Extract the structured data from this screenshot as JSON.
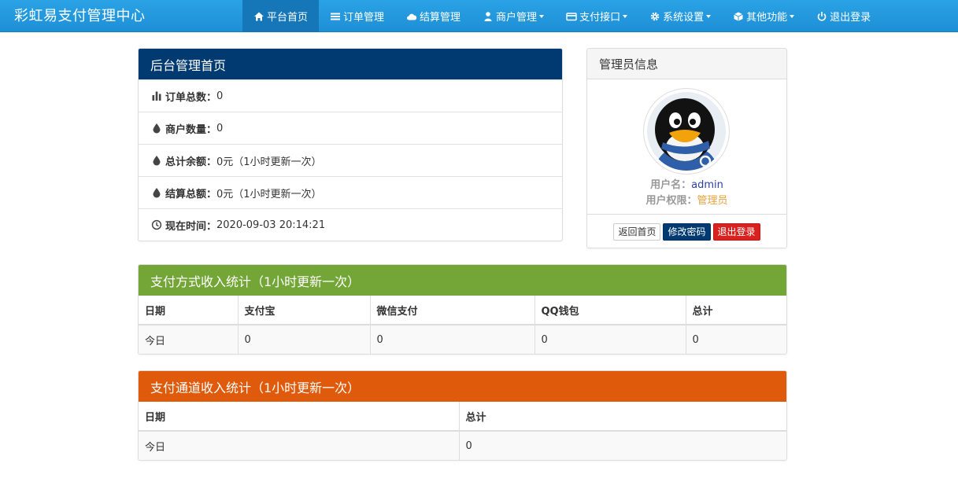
{
  "nav": {
    "brand": "彩虹易支付管理中心",
    "items": [
      {
        "label": "平台首页",
        "icon": "home-icon",
        "dropdown": false,
        "active": true
      },
      {
        "label": "订单管理",
        "icon": "list-icon",
        "dropdown": false,
        "active": false
      },
      {
        "label": "结算管理",
        "icon": "cloud-icon",
        "dropdown": false,
        "active": false
      },
      {
        "label": "商户管理",
        "icon": "user-icon",
        "dropdown": true,
        "active": false
      },
      {
        "label": "支付接口",
        "icon": "credit-card-icon",
        "dropdown": true,
        "active": false
      },
      {
        "label": "系统设置",
        "icon": "cog-icon",
        "dropdown": true,
        "active": false
      },
      {
        "label": "其他功能",
        "icon": "cube-icon",
        "dropdown": true,
        "active": false
      },
      {
        "label": "退出登录",
        "icon": "power-icon",
        "dropdown": false,
        "active": false
      }
    ]
  },
  "home": {
    "title": "后台管理首页",
    "rows": [
      {
        "icon": "stats-icon",
        "label": "订单总数：",
        "value": "0"
      },
      {
        "icon": "drop-icon",
        "label": "商户数量：",
        "value": "0"
      },
      {
        "icon": "drop-icon",
        "label": "总计余额：",
        "value": "0元（1小时更新一次）"
      },
      {
        "icon": "drop-icon",
        "label": "结算总额：",
        "value": "0元（1小时更新一次）"
      },
      {
        "icon": "clock-icon",
        "label": "现在时间：",
        "value": " 2020-09-03 20:14:21"
      }
    ]
  },
  "admin": {
    "title": "管理员信息",
    "username_label": "用户名：",
    "username": "admin",
    "role_label": "用户权限：",
    "role": "管理员",
    "buttons": {
      "home": "返回首页",
      "password": "修改密码",
      "logout": "退出登录"
    }
  },
  "pay_stats": {
    "title": "支付方式收入统计（1小时更新一次）",
    "headers": [
      "日期",
      "支付宝",
      "微信支付",
      "QQ钱包",
      "总计"
    ],
    "rows": [
      [
        "今日",
        "0",
        "0",
        "0",
        "0"
      ]
    ]
  },
  "channel_stats": {
    "title": "支付通道收入统计（1小时更新一次）",
    "headers": [
      "日期",
      "总计"
    ],
    "rows": [
      [
        "今日",
        "0"
      ]
    ]
  },
  "colors": {
    "navbar": "#2aa2e6",
    "primary_panel": "#003a70",
    "success_panel": "#74a637",
    "warning_panel": "#e05a0b",
    "danger": "#d9221f"
  }
}
